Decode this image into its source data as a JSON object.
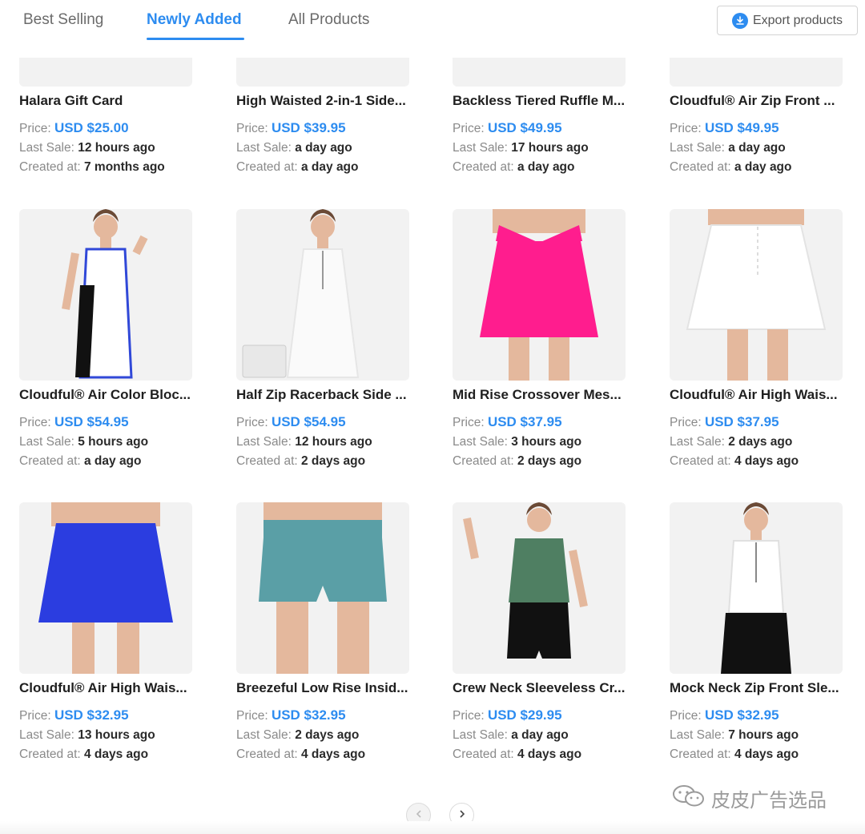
{
  "tabs": [
    {
      "label": "Best Selling",
      "active": false
    },
    {
      "label": "Newly Added",
      "active": true
    },
    {
      "label": "All Products",
      "active": false
    }
  ],
  "export_label": "Export products",
  "labels": {
    "price": "Price:",
    "last_sale": "Last Sale:",
    "created_at": "Created at:"
  },
  "products": [
    {
      "name": "Halara Gift Card",
      "price": "USD $25.00",
      "last_sale": "12 hours ago",
      "created_at": "7 months ago",
      "image": "gift-card",
      "colors": [
        "#e8e8e8",
        "#e8e8e8"
      ]
    },
    {
      "name": "High Waisted 2-in-1 Side...",
      "price": "USD $39.95",
      "last_sale": "a day ago",
      "created_at": "a day ago",
      "image": "legs",
      "colors": [
        "#e0b49a",
        "#e0b49a"
      ]
    },
    {
      "name": "Backless Tiered Ruffle M...",
      "price": "USD $49.95",
      "last_sale": "17 hours ago",
      "created_at": "a day ago",
      "image": "teal-dress",
      "colors": [
        "#25525a",
        "#25525a"
      ]
    },
    {
      "name": "Cloudful® Air Zip Front ...",
      "price": "USD $49.95",
      "last_sale": "a day ago",
      "created_at": "a day ago",
      "image": "blue-dress",
      "colors": [
        "#2d47d6",
        "#2d47d6"
      ]
    },
    {
      "name": "Cloudful® Air Color Bloc...",
      "price": "USD $54.95",
      "last_sale": "5 hours ago",
      "created_at": "a day ago",
      "image": "tennis-dress-colorblock",
      "colors": [
        "#ffffff",
        "#111111"
      ]
    },
    {
      "name": "Half Zip Racerback Side ...",
      "price": "USD $54.95",
      "last_sale": "12 hours ago",
      "created_at": "2 days ago",
      "image": "tennis-dress-white",
      "colors": [
        "#fafafa",
        "#fafafa"
      ]
    },
    {
      "name": "Mid Rise Crossover Mes...",
      "price": "USD $37.95",
      "last_sale": "3 hours ago",
      "created_at": "2 days ago",
      "image": "pink-skirt",
      "colors": [
        "#ff1d8e",
        "#ff1d8e"
      ]
    },
    {
      "name": "Cloudful® Air High Wais...",
      "price": "USD $37.95",
      "last_sale": "2 days ago",
      "created_at": "4 days ago",
      "image": "white-skirt",
      "colors": [
        "#ffffff",
        "#ffffff"
      ]
    },
    {
      "name": "Cloudful® Air High Wais...",
      "price": "USD $32.95",
      "last_sale": "13 hours ago",
      "created_at": "4 days ago",
      "image": "blue-skirt",
      "colors": [
        "#2b3de0",
        "#2b3de0"
      ]
    },
    {
      "name": "Breezeful Low Rise Insid...",
      "price": "USD $32.95",
      "last_sale": "2 days ago",
      "created_at": "4 days ago",
      "image": "teal-shorts",
      "colors": [
        "#5a9fa6",
        "#5a9fa6"
      ]
    },
    {
      "name": "Crew Neck Sleeveless Cr...",
      "price": "USD $29.95",
      "last_sale": "a day ago",
      "created_at": "4 days ago",
      "image": "green-top",
      "colors": [
        "#4f7f62",
        "#111111"
      ]
    },
    {
      "name": "Mock Neck Zip Front Sle...",
      "price": "USD $32.95",
      "last_sale": "7 hours ago",
      "created_at": "4 days ago",
      "image": "white-top",
      "colors": [
        "#ffffff",
        "#111111"
      ]
    }
  ],
  "pagination": {
    "prev_icon": "chevron-left-icon",
    "next_icon": "chevron-right-icon",
    "prev_disabled": true
  },
  "watermark": "皮皮广告选品",
  "accent_color": "#2d8cf0"
}
